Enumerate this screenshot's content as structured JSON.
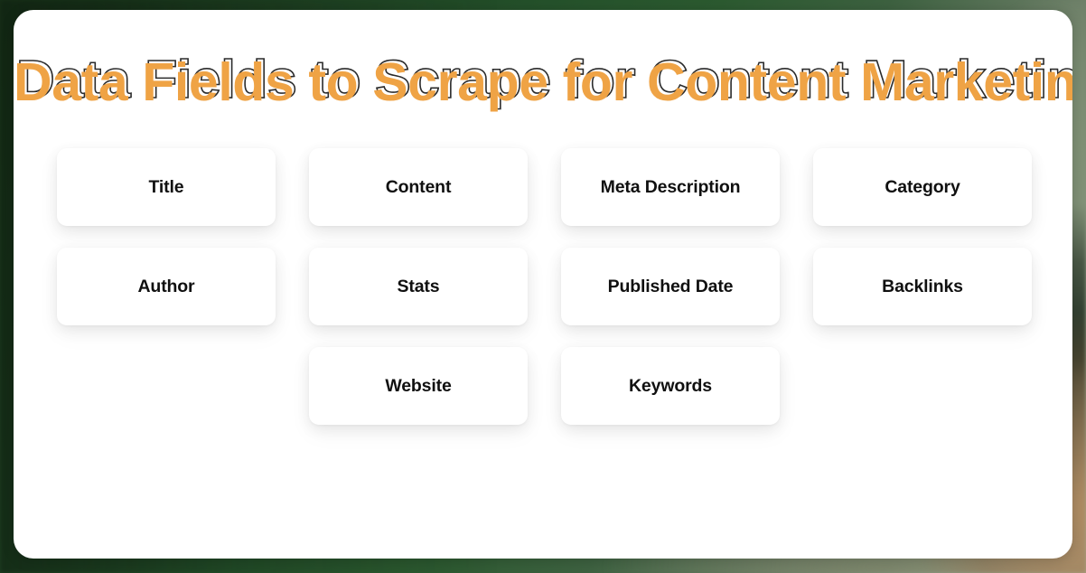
{
  "theme": {
    "accent_orange": "#efa345",
    "outline_dark": "#2b2b2b",
    "panel_background": "#ffffff",
    "page_background_green": "#1f4023",
    "card_text": "#101010"
  },
  "header": {
    "title": "Data Fields to Scrape for Content Marketing"
  },
  "grid": {
    "rows": [
      {
        "cards": [
          {
            "label": "Title"
          },
          {
            "label": "Content"
          },
          {
            "label": "Meta Description"
          },
          {
            "label": "Category"
          }
        ]
      },
      {
        "cards": [
          {
            "label": "Author"
          },
          {
            "label": "Stats"
          },
          {
            "label": "Published Date"
          },
          {
            "label": "Backlinks"
          }
        ]
      },
      {
        "cards": [
          {
            "label": "Website"
          },
          {
            "label": "Keywords"
          }
        ]
      }
    ]
  }
}
